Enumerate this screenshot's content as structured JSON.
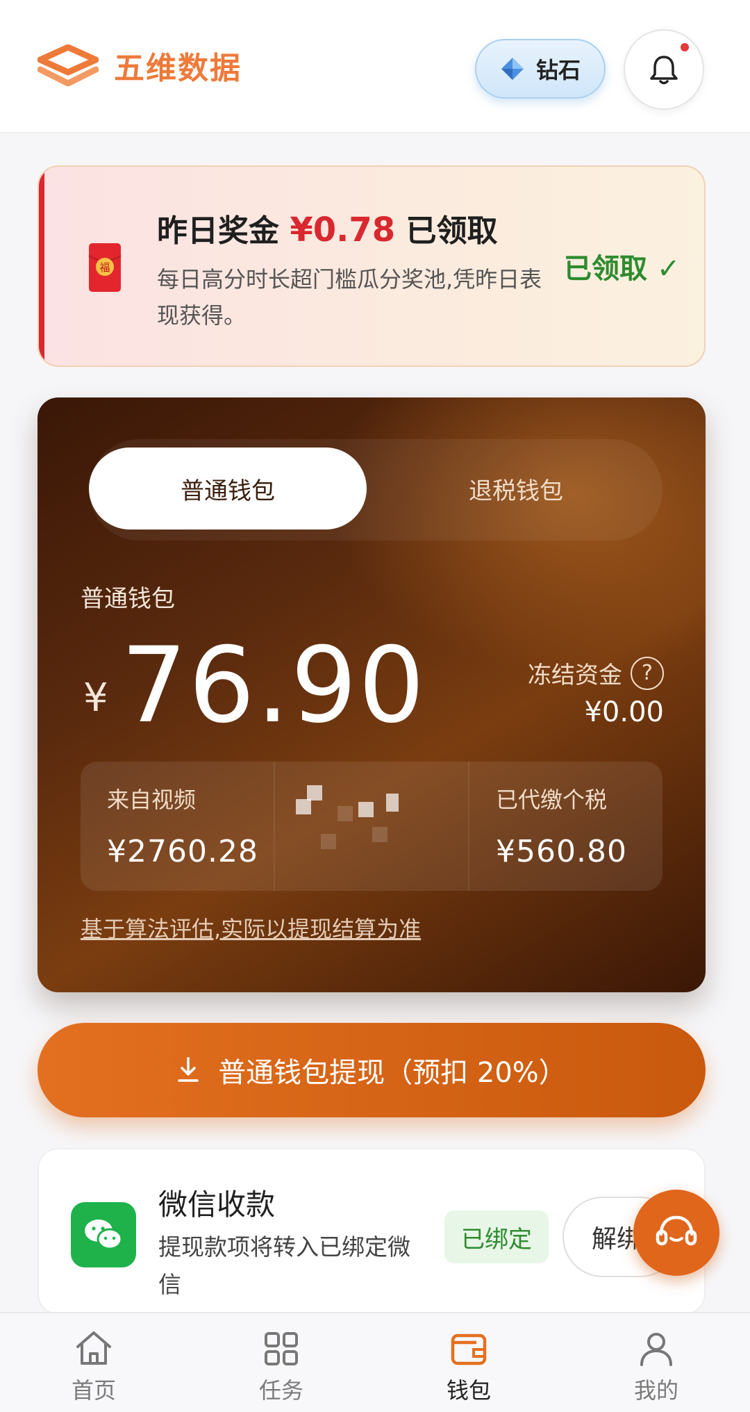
{
  "header": {
    "logo_text": "五维数据",
    "diamond_label": "钻石",
    "has_unread_notifications": true
  },
  "bonus": {
    "title_prefix": "昨日奖金",
    "amount": "¥0.78",
    "title_suffix": "已领取",
    "description": "每日高分时长超门槛瓜分奖池,凭昨日表现获得。",
    "status": "已领取 ✓",
    "envelope_char": "福"
  },
  "wallet": {
    "tabs": [
      {
        "label": "普通钱包",
        "active": true
      },
      {
        "label": "退税钱包",
        "active": false
      }
    ],
    "name": "普通钱包",
    "currency": "¥",
    "balance": "76.90",
    "frozen_label": "冻结资金",
    "frozen_value": "¥0.00",
    "stats": [
      {
        "label": "来自视频",
        "value": "¥2760.28"
      },
      {
        "label": "",
        "value": ""
      },
      {
        "label": "已代缴个税",
        "value": "¥560.80"
      }
    ],
    "disclaimer": "基于算法评估,实际以提现结算为准"
  },
  "withdraw": {
    "label": "普通钱包提现（预扣 20%）"
  },
  "wechat": {
    "title": "微信收款",
    "description": "提现款项将转入已绑定微信",
    "bound_label": "已绑定",
    "unbind_label": "解绑"
  },
  "bottom_nav": [
    {
      "label": "首页",
      "icon": "home-icon",
      "active": false
    },
    {
      "label": "任务",
      "icon": "grid-icon",
      "active": false
    },
    {
      "label": "钱包",
      "icon": "wallet-icon",
      "active": true
    },
    {
      "label": "我的",
      "icon": "user-icon",
      "active": false
    }
  ],
  "colors": {
    "brand_orange": "#e37020",
    "bonus_red": "#d9282f",
    "success_green": "#2e8b2e",
    "wallet_dark": "#3a1707"
  }
}
